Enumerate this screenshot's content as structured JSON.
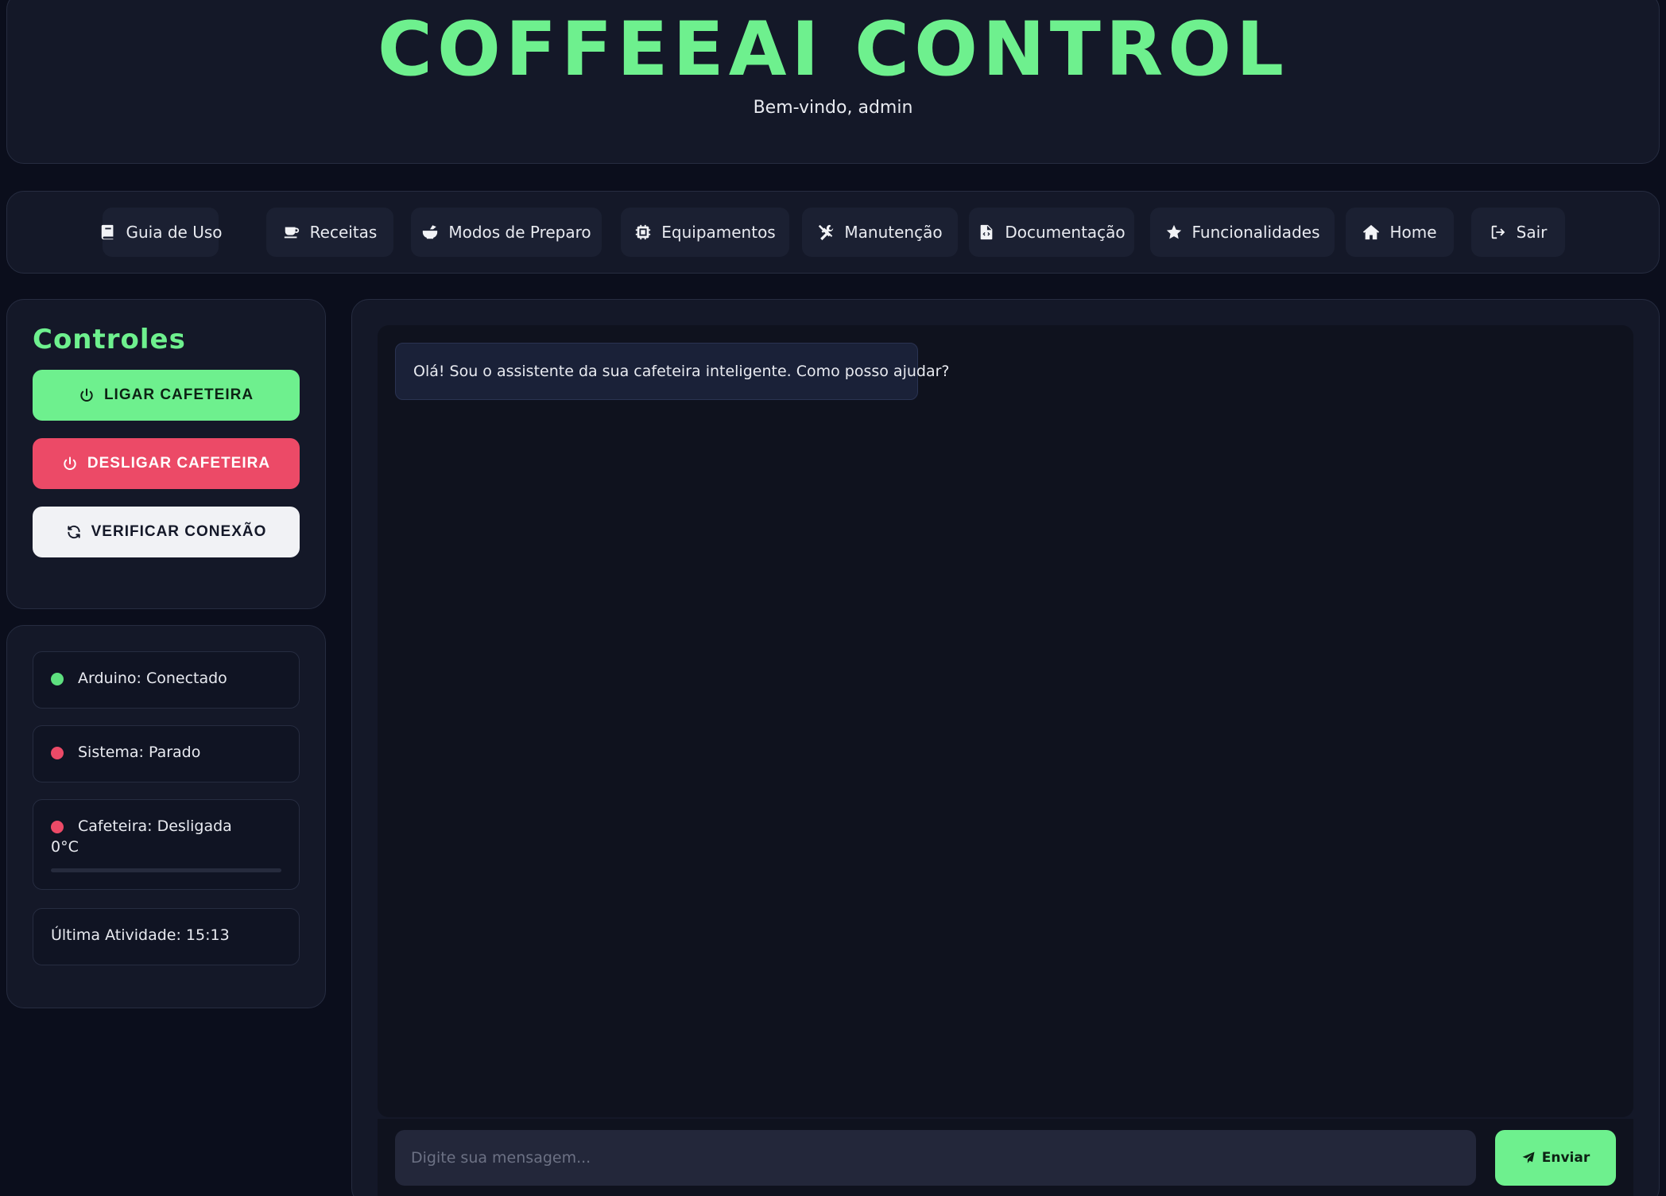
{
  "header": {
    "title": "COFFEEAI CONTROL",
    "welcome": "Bem-vindo, admin"
  },
  "nav": {
    "items": [
      {
        "label": "Guia de Uso",
        "icon": "book-icon"
      },
      {
        "label": "Receitas",
        "icon": "coffee-cup-icon"
      },
      {
        "label": "Modos de Preparo",
        "icon": "mortar-pestle-icon"
      },
      {
        "label": "Equipamentos",
        "icon": "microchip-icon"
      },
      {
        "label": "Manutenção",
        "icon": "tools-icon"
      },
      {
        "label": "Documentação",
        "icon": "file-code-icon"
      },
      {
        "label": "Funcionalidades",
        "icon": "star-icon"
      },
      {
        "label": "Home",
        "icon": "home-icon"
      },
      {
        "label": "Sair",
        "icon": "sign-out-icon"
      }
    ]
  },
  "controls": {
    "title": "Controles",
    "on_label": "LIGAR CAFETEIRA",
    "off_label": "DESLIGAR CAFETEIRA",
    "check_label": "VERIFICAR CONEXÃO"
  },
  "status": {
    "arduino": {
      "text": "Arduino: Conectado",
      "color": "#5ee07f"
    },
    "system": {
      "text": "Sistema: Parado",
      "color": "#ec4a67"
    },
    "coffee_maker": {
      "text": "Cafeteira: Desligada",
      "color": "#ec4a67"
    },
    "temperature": "0°C",
    "temperature_progress": 0,
    "last_activity": "Última Atividade: 15:13"
  },
  "chat": {
    "messages": [
      {
        "sender": "assistant",
        "text": "Olá! Sou o assistente da sua cafeteira inteligente. Como posso ajudar?"
      }
    ],
    "input_placeholder": "Digite sua mensagem...",
    "send_label": "Enviar"
  },
  "colors": {
    "accent": "#6ef08e",
    "danger": "#ec4a67",
    "background": "#0b0e1c",
    "panel": "#141828"
  }
}
